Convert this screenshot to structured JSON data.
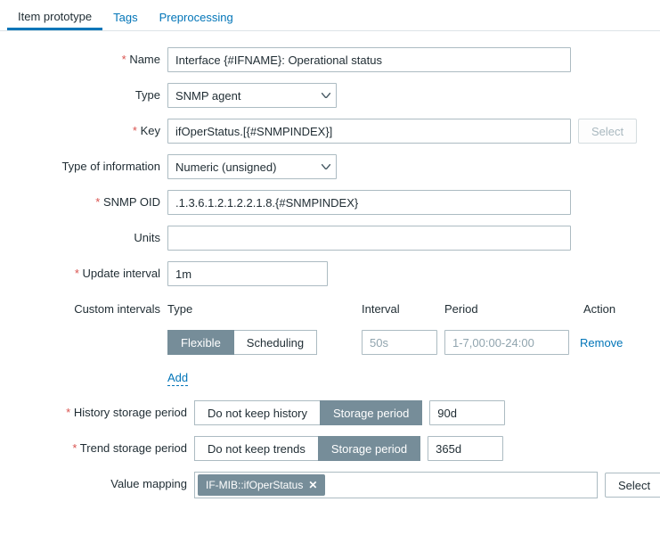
{
  "tabs": {
    "item_prototype": "Item prototype",
    "tags": "Tags",
    "preprocessing": "Preprocessing"
  },
  "labels": {
    "name": "Name",
    "type": "Type",
    "key": "Key",
    "type_of_information": "Type of information",
    "snmp_oid": "SNMP OID",
    "units": "Units",
    "update_interval": "Update interval",
    "custom_intervals": "Custom intervals",
    "history_storage_period": "History storage period",
    "trend_storage_period": "Trend storage period",
    "value_mapping": "Value mapping"
  },
  "values": {
    "name": "Interface {#IFNAME}: Operational status",
    "type": "SNMP agent",
    "key": "ifOperStatus.[{#SNMPINDEX}]",
    "type_of_information": "Numeric (unsigned)",
    "snmp_oid": ".1.3.6.1.2.1.2.2.1.8.{#SNMPINDEX}",
    "units": "",
    "update_interval": "1m",
    "history_value": "90d",
    "trend_value": "365d",
    "value_mapping_tag": "IF-MIB::ifOperStatus"
  },
  "custom_intervals": {
    "head_type": "Type",
    "head_interval": "Interval",
    "head_period": "Period",
    "head_action": "Action",
    "seg_flexible": "Flexible",
    "seg_scheduling": "Scheduling",
    "interval_placeholder": "50s",
    "period_placeholder": "1-7,00:00-24:00",
    "remove": "Remove",
    "add": "Add"
  },
  "history_seg": {
    "do_not_keep": "Do not keep history",
    "storage_period": "Storage period"
  },
  "trend_seg": {
    "do_not_keep": "Do not keep trends",
    "storage_period": "Storage period"
  },
  "buttons": {
    "select": "Select"
  }
}
